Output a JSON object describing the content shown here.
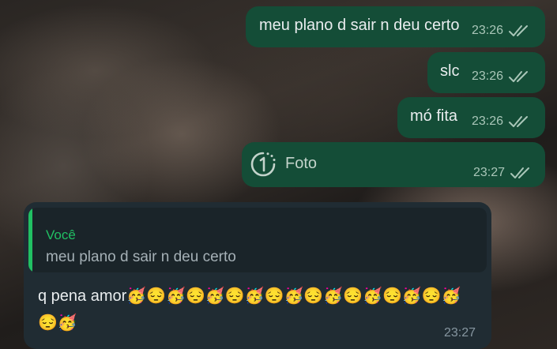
{
  "chat": {
    "outgoing": [
      {
        "text": "meu plano d sair n deu certo",
        "time": "23:26",
        "status": "read"
      },
      {
        "text": "slc",
        "time": "23:26",
        "status": "read"
      },
      {
        "text": "mó fita",
        "time": "23:26",
        "status": "read"
      },
      {
        "text": "Foto",
        "time": "23:27",
        "status": "read",
        "icon": "view-once-icon"
      }
    ],
    "incoming": {
      "quote": {
        "author": "Você",
        "text": "meu plano d sair n deu certo"
      },
      "text": "q pena amor🥳😔🥳😔🥳😔🥳😔🥳😔🥳😔🥳😔🥳😔🥳😔🥳",
      "time": "23:27"
    }
  },
  "colors": {
    "outgoing_bubble": "#144d37",
    "incoming_bubble": "#202c33",
    "quote_accent": "#21c063"
  }
}
